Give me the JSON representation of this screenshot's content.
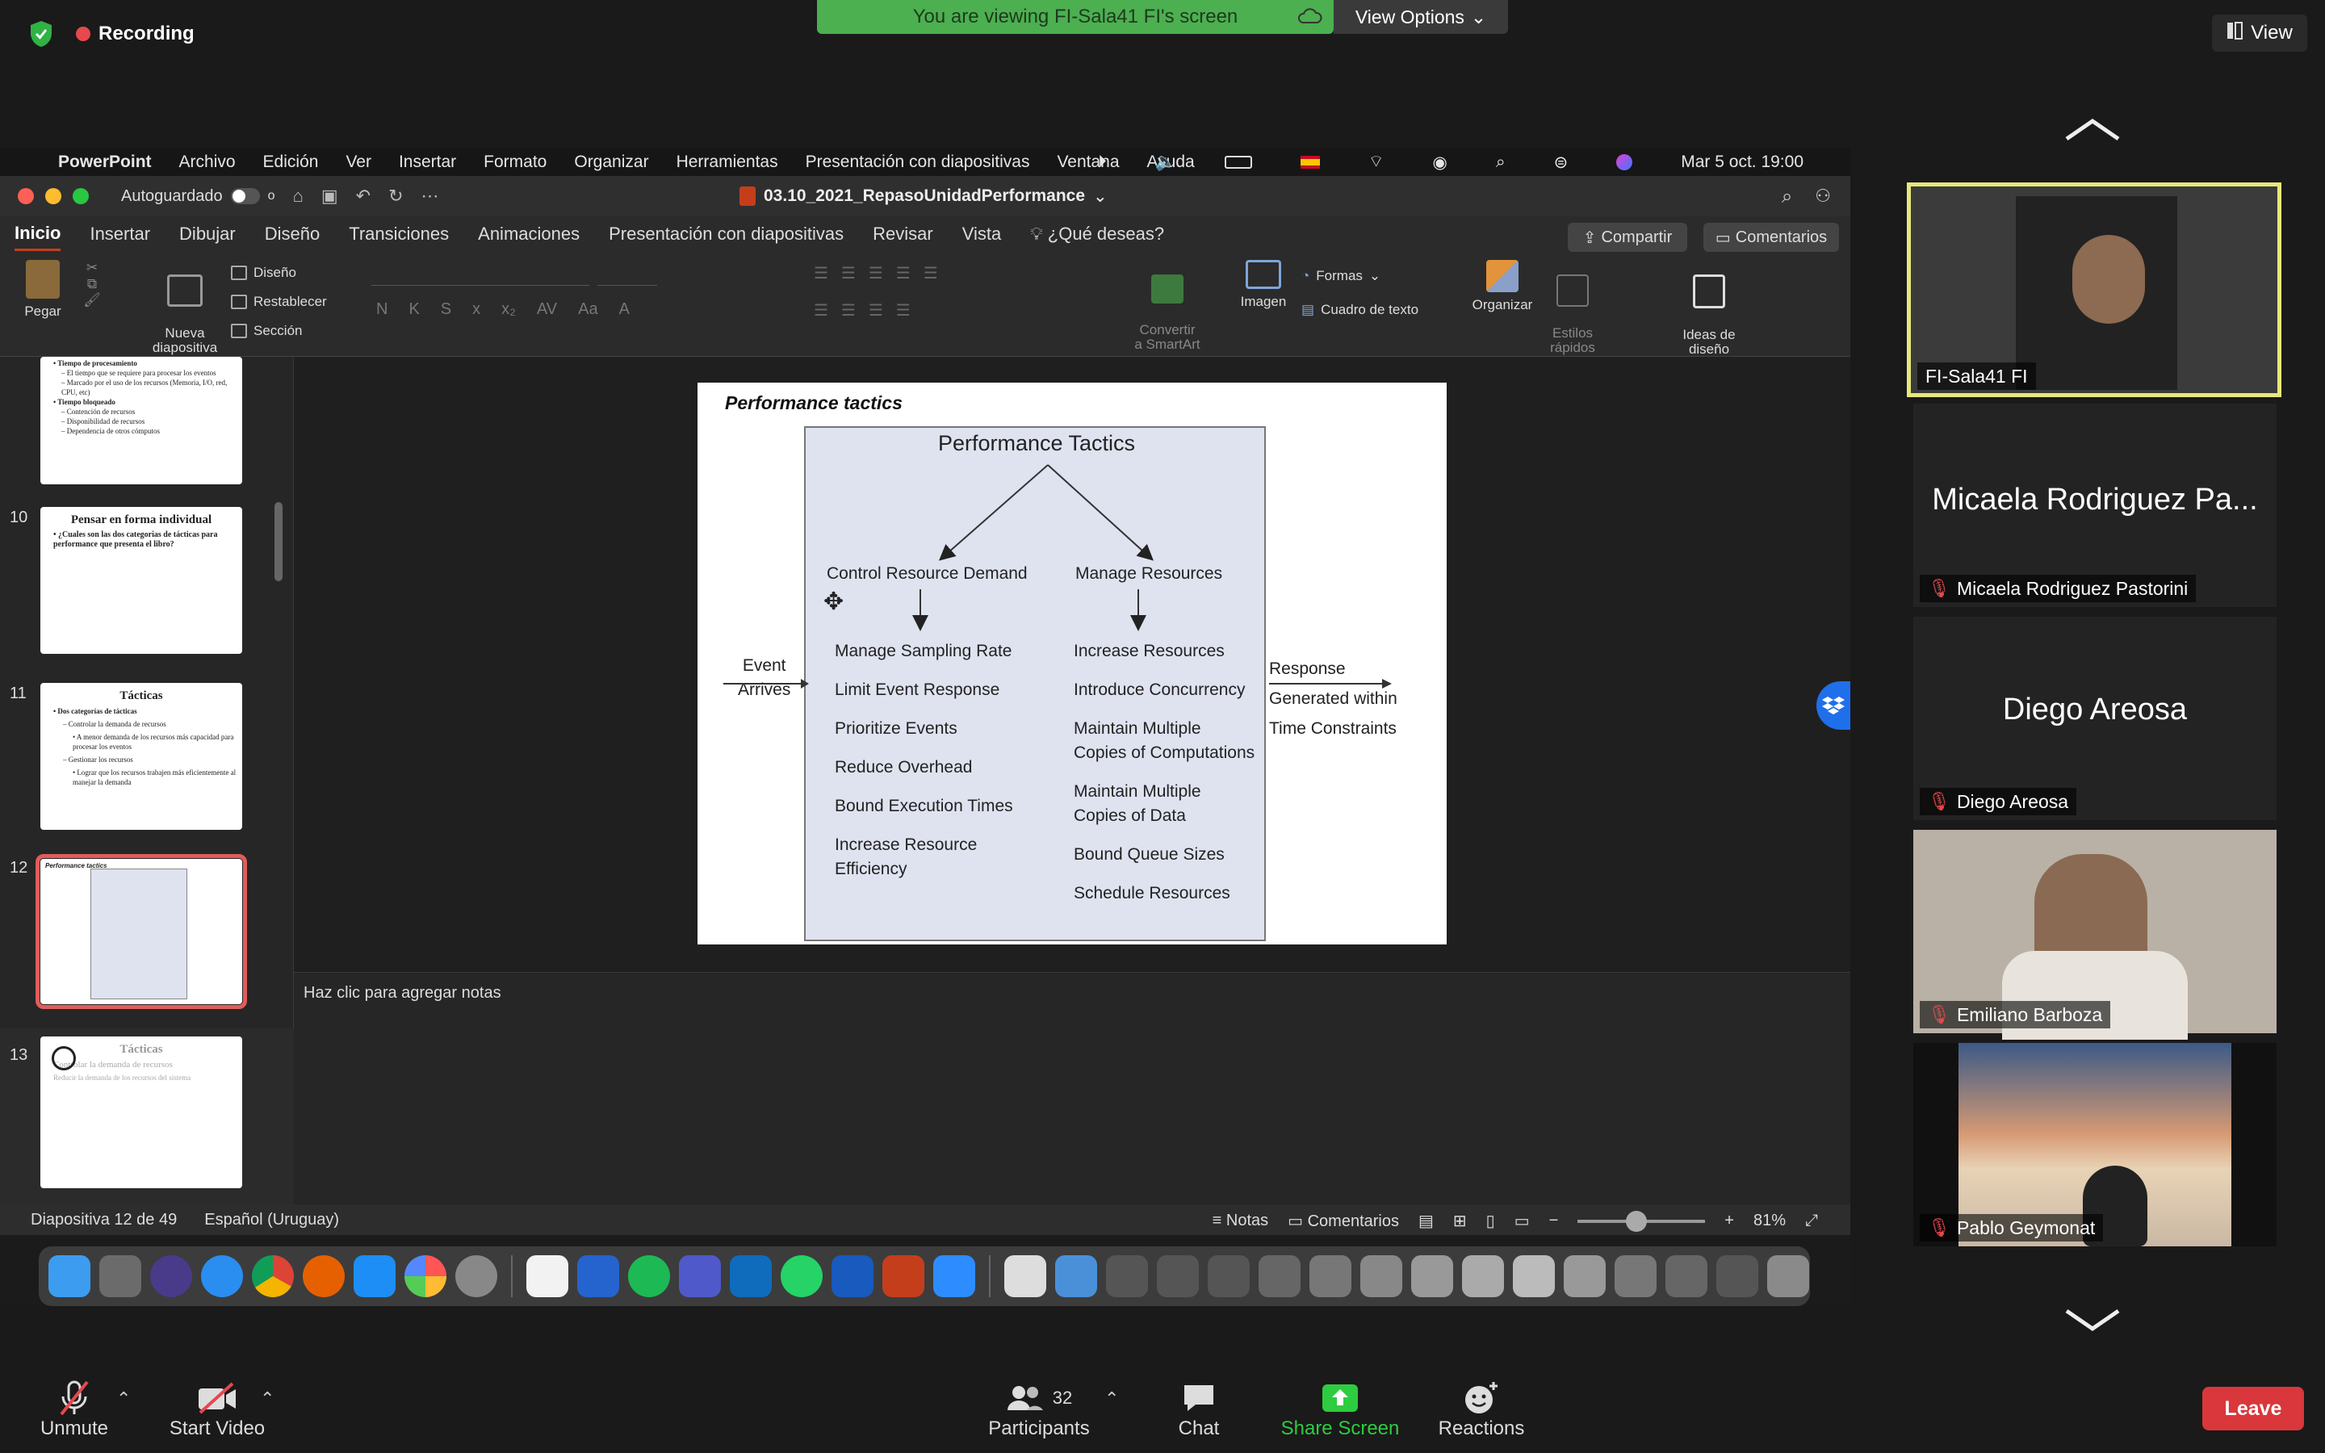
{
  "zoom": {
    "recording_label": "Recording",
    "banner_text": "You are viewing FI-Sala41 FI's screen",
    "view_options_label": "View Options",
    "view_label": "View",
    "participants": [
      {
        "name": "FI-Sala41 FI",
        "video": true,
        "active": true
      },
      {
        "name": "Micaela Rodriguez Pastorini",
        "display": "Micaela Rodriguez Pa...",
        "muted": true
      },
      {
        "name": "Diego Areosa",
        "display": "Diego Areosa",
        "muted": true
      },
      {
        "name": "Emiliano Barboza",
        "video": true,
        "muted": true
      },
      {
        "name": "Pablo Geymonat",
        "video": true,
        "muted": true
      }
    ],
    "bottom": {
      "unmute": "Unmute",
      "start_video": "Start Video",
      "participants": "Participants",
      "participants_count": "32",
      "chat": "Chat",
      "share_screen": "Share Screen",
      "reactions": "Reactions",
      "leave": "Leave"
    },
    "colors": {
      "banner": "#4caf50",
      "active_border": "#e8e87a",
      "leave": "#d9373b",
      "share": "#2ecc40"
    }
  },
  "menubar": {
    "apple": "",
    "items": [
      "PowerPoint",
      "Archivo",
      "Edición",
      "Ver",
      "Insertar",
      "Formato",
      "Organizar",
      "Herramientas",
      "Presentación con diapositivas",
      "Ventana",
      "Ayuda"
    ],
    "clock": "Mar 5 oct. 19:00"
  },
  "ppt": {
    "autosave": "Autoguardado",
    "autosave_state": "o",
    "doc_title": "03.10_2021_RepasoUnidadPerformance",
    "tabs": [
      "Inicio",
      "Insertar",
      "Dibujar",
      "Diseño",
      "Transiciones",
      "Animaciones",
      "Presentación con diapositivas",
      "Revisar",
      "Vista"
    ],
    "help": "¿Qué deseas?",
    "share": "Compartir",
    "comments": "Comentarios",
    "ribbon": {
      "paste": "Pegar",
      "new_slide": "Nueva\ndiapositiva",
      "layout": "Diseño",
      "reset": "Restablecer",
      "section": "Sección",
      "convert": "Convertir\na SmartArt",
      "image": "Imagen",
      "shapes": "Formas",
      "textbox": "Cuadro de texto",
      "arrange": "Organizar",
      "quick_styles": "Estilos\nrápidos",
      "design_ideas": "Ideas de\ndiseño",
      "fmt_letters": [
        "N",
        "K",
        "S",
        "x",
        "x₂",
        "AV",
        "Aa",
        "A"
      ]
    },
    "thumbnails": [
      {
        "num": "",
        "title": "",
        "lines": [
          "• Tiempo de procesamiento",
          "– El tiempo que se requiere para procesar los eventos",
          "– Marcado por el uso de los recursos (Memoria, I/O, red, CPU, etc)",
          "",
          "• Tiempo bloqueado",
          "– Contención de recursos",
          "– Disponibilidad de recursos",
          "– Dependencia de otros cómputos"
        ]
      },
      {
        "num": "10",
        "title": "Pensar en forma individual",
        "lines": [
          "• ¿Cuales son las dos categorias de tácticas para performance que presenta el libro?"
        ]
      },
      {
        "num": "11",
        "title": "Tácticas",
        "lines": [
          "• Dos categorías de tácticas",
          "– Controlar la demanda de recursos",
          "• A menor demanda de los recursos más capacidad para procesar los eventos",
          "– Gestionar los recursos",
          "• Lograr que los recursos trabajen más eficientemente al manejar la demanda"
        ]
      },
      {
        "num": "12",
        "title": "Performance tactics",
        "lines": []
      },
      {
        "num": "13",
        "title": "Tácticas",
        "lines": [
          "Controlar la demanda de recursos",
          "Reducir la demanda de los recursos del sistema"
        ]
      }
    ],
    "slide": {
      "title": "Performance tactics",
      "diagram_title": "Performance Tactics",
      "left_branch": "Control Resource Demand",
      "right_branch": "Manage Resources",
      "event_label": [
        "Event",
        "Arrives"
      ],
      "response_label": [
        "Response",
        "Generated within",
        "Time Constraints"
      ],
      "left_items": [
        "Manage Sampling Rate",
        "Limit Event Response",
        "Prioritize Events",
        "Reduce Overhead",
        "Bound Execution Times",
        "Increase Resource\nEfficiency"
      ],
      "right_items": [
        "Increase Resources",
        "Introduce Concurrency",
        "Maintain Multiple\nCopies of Computations",
        "Maintain Multiple\nCopies of Data",
        "Bound Queue Sizes",
        "Schedule Resources"
      ]
    },
    "notes_placeholder": "Haz clic para agregar notas",
    "status": {
      "slide": "Diapositiva 12 de 49",
      "lang": "Español (Uruguay)",
      "notes": "Notas",
      "comments": "Comentarios",
      "zoom": "81%"
    }
  }
}
